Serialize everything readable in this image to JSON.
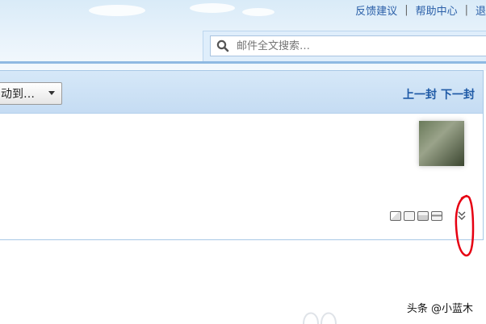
{
  "header": {
    "links": [
      "反馈建议",
      "帮助中心",
      "退"
    ],
    "separator": "|"
  },
  "search": {
    "placeholder": "邮件全文搜索…",
    "icon": "search-icon"
  },
  "toolbar": {
    "move_label": "动到…",
    "prev_label": "上一封",
    "next_label": "下一封"
  },
  "mail_actions": {
    "icons": [
      "new-window-icon",
      "note-icon",
      "export-icon",
      "print-icon",
      "expand-icon"
    ]
  },
  "watermark": "头条 @小蓝木",
  "colors": {
    "accent_link": "#1f5aa6",
    "toolbar_bg": "#c5dcf3",
    "annotation_red": "#e60012"
  }
}
